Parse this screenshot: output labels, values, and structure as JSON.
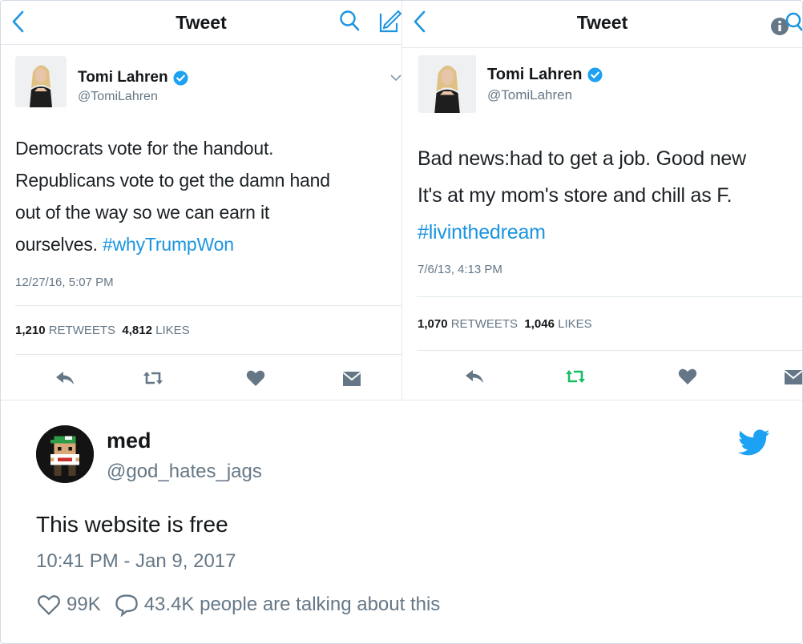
{
  "left": {
    "nav_title": "Tweet",
    "author_name": "Tomi Lahren",
    "author_handle": "@TomiLahren",
    "text_lines": [
      "Democrats vote for the handout.",
      "Republicans vote to get the damn hand",
      "out of the way so we can earn it"
    ],
    "text_last_plain": "ourselves. ",
    "hashtag": "#whyTrumpWon",
    "timestamp": "12/27/16, 5:07 PM",
    "retweets": "1,210",
    "retweets_label": "RETWEETS",
    "likes": "4,812",
    "likes_label": "LIKES"
  },
  "right": {
    "nav_title": "Tweet",
    "author_name": "Tomi Lahren",
    "author_handle": "@TomiLahren",
    "text_lines": [
      "Bad news:had to get a job. Good new",
      "It's at my mom's store and chill as F."
    ],
    "hashtag": "#livinthedream",
    "timestamp": "7/6/13, 4:13 PM",
    "retweets": "1,070",
    "retweets_label": "RETWEETS",
    "likes": "1,046",
    "likes_label": "LIKES"
  },
  "card": {
    "name": "med",
    "handle": "@god_hates_jags",
    "text": "This website is free",
    "time": "10:41 PM - Jan 9, 2017",
    "likes": "99K",
    "talking": "43.4K people are talking about this"
  },
  "colors": {
    "accent": "#1b95e0",
    "icon_gray": "#657786",
    "retweet_active": "#17bf63",
    "twitter_blue": "#1da1f2"
  },
  "icons": [
    "back-chevron-icon",
    "search-icon",
    "compose-icon",
    "verified-badge-icon",
    "reply-icon",
    "retweet-icon",
    "heart-icon",
    "dm-icon",
    "twitter-bird-icon",
    "info-icon"
  ]
}
